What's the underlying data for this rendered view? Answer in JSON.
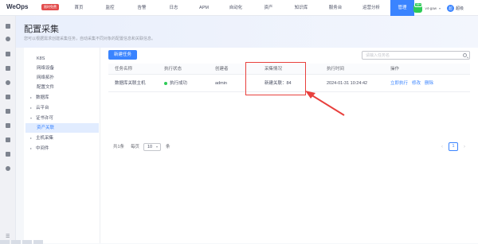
{
  "header": {
    "logo": "WeOps",
    "badge": "限时免费",
    "nav": [
      "首页",
      "监控",
      "告警",
      "日志",
      "APM",
      "自动化",
      "资产",
      "知识库",
      "服务台",
      "运营分析",
      "管理"
    ],
    "active_nav": "管理",
    "app_badge": "99+",
    "org": "v4-gaw",
    "avatar_text": "超",
    "user": "超级"
  },
  "page": {
    "title": "配置采集",
    "description": "您可以根据需求创建采集任务，自动采集不同对象的配置信息和关联信息。"
  },
  "tree": {
    "items": [
      {
        "label": "K8S",
        "arrow": ""
      },
      {
        "label": "网络设备",
        "arrow": ""
      },
      {
        "label": "网络拓扑",
        "arrow": ""
      },
      {
        "label": "配置文件",
        "arrow": ""
      },
      {
        "label": "数据库",
        "arrow": "▸"
      },
      {
        "label": "云平台",
        "arrow": "▸"
      },
      {
        "label": "证书许可",
        "arrow": "▾"
      },
      {
        "label": "资产关联",
        "arrow": ""
      },
      {
        "label": "主机采集",
        "arrow": "▸"
      },
      {
        "label": "中间件",
        "arrow": "▸"
      }
    ],
    "selected": "资产关联"
  },
  "toolbar": {
    "new_task": "新建任务",
    "search_placeholder": "请输入任务名"
  },
  "table": {
    "columns": [
      "任务名称",
      "执行状态",
      "创建者",
      "采集情况",
      "执行时间",
      "操作"
    ],
    "rows": [
      {
        "name": "数据库关联主机",
        "status": "执行成功",
        "creator": "admin",
        "collect": "新建关联：84",
        "time": "2024-01-31 10:24:42",
        "actions": [
          "立即执行",
          "修改",
          "删除"
        ]
      }
    ]
  },
  "pagination": {
    "total": "共1条",
    "per_page_label": "每页",
    "per_page": "10",
    "unit": "条",
    "current_page": "1"
  },
  "colors": {
    "primary": "#3a84ff",
    "success": "#2dcb56",
    "annotation": "#e8403d"
  }
}
